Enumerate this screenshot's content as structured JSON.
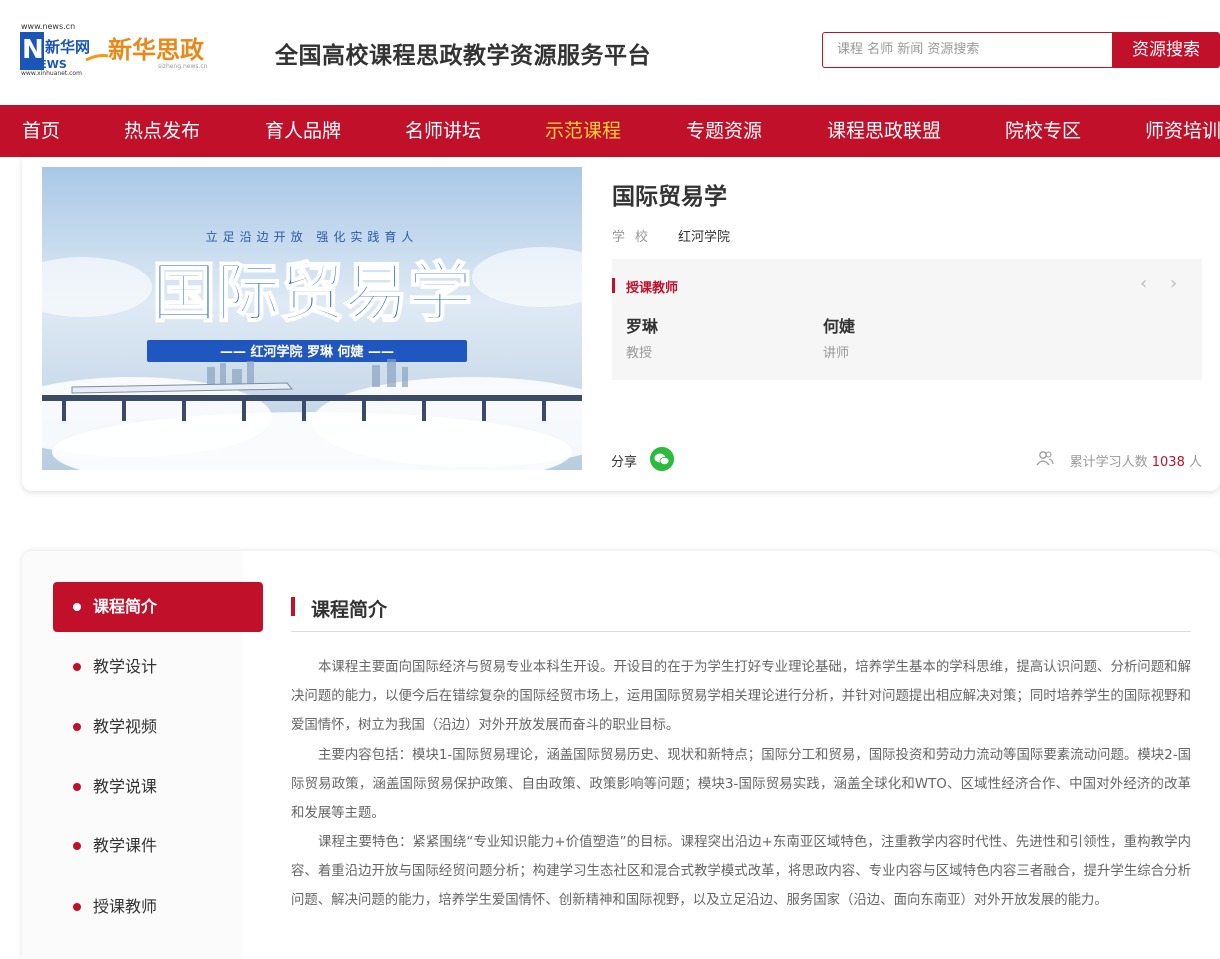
{
  "header": {
    "logo": {
      "url_text": "www.news.cn",
      "brand_cn": "新华网",
      "brand_en": "NEWS",
      "sub_url": "www.xinhuanet.com",
      "name": "新华思政",
      "name_url": "sizheng.news.cn"
    },
    "site_title": "全国高校课程思政教学资源服务平台",
    "search_placeholder": "课程 名师 新闻 资源搜索",
    "search_button": "资源搜索"
  },
  "nav": {
    "items": [
      "首页",
      "热点发布",
      "育人品牌",
      "名师讲坛",
      "示范课程",
      "专题资源",
      "课程思政联盟",
      "院校专区",
      "师资培训"
    ],
    "active_index": 4
  },
  "banner": {
    "tagline": "立足沿边开放  强化实践育人",
    "title": "国际贸易学",
    "subtitle": "—— 红河学院  罗琳  何婕 ——"
  },
  "course": {
    "title": "国际贸易学",
    "school_label": "学校",
    "school": "红河学院",
    "teachers_heading": "授课教师",
    "teachers": [
      {
        "name": "罗琳",
        "title": "教授"
      },
      {
        "name": "何婕",
        "title": "讲师"
      }
    ],
    "share_label": "分享",
    "learners_label": "累计学习人数",
    "learners_count": "1038",
    "learners_unit": "人"
  },
  "sidebar": {
    "items": [
      "课程简介",
      "教学设计",
      "教学视频",
      "教学说课",
      "教学课件",
      "授课教师"
    ],
    "active_index": 0
  },
  "intro": {
    "title": "课程简介",
    "paragraphs": [
      "本课程主要面向国际经济与贸易专业本科生开设。开设目的在于为学生打好专业理论基础，培养学生基本的学科思维，提高认识问题、分析问题和解决问题的能力，以便今后在错综复杂的国际经贸市场上，运用国际贸易学相关理论进行分析，并针对问题提出相应解决对策；同时培养学生的国际视野和爱国情怀，树立为我国（沿边）对外开放发展而奋斗的职业目标。",
      "主要内容包括：模块1-国际贸易理论，涵盖国际贸易历史、现状和新特点；国际分工和贸易，国际投资和劳动力流动等国际要素流动问题。模块2-国际贸易政策，涵盖国际贸易保护政策、自由政策、政策影响等问题；模块3-国际贸易实践，涵盖全球化和WTO、区域性经济合作、中国对外经济的改革和发展等主题。",
      "课程主要特色：紧紧围绕“专业知识能力+价值塑造”的目标。课程突出沿边+东南亚区域特色，注重教学内容时代性、先进性和引领性，重构教学内容、着重沿边开放与国际经贸问题分析；构建学习生态社区和混合式教学模式改革，将思政内容、专业内容与区域特色内容三者融合，提升学生综合分析问题、解决问题的能力，培养学生爱国情怀、创新精神和国际视野，以及立足沿边、服务国家（沿边、面向东南亚）对外开放发展的能力。"
    ]
  },
  "colors": {
    "brand_red": "#c0102a",
    "nav_active": "#ffd13b",
    "wechat_green": "#2dbb3e"
  }
}
